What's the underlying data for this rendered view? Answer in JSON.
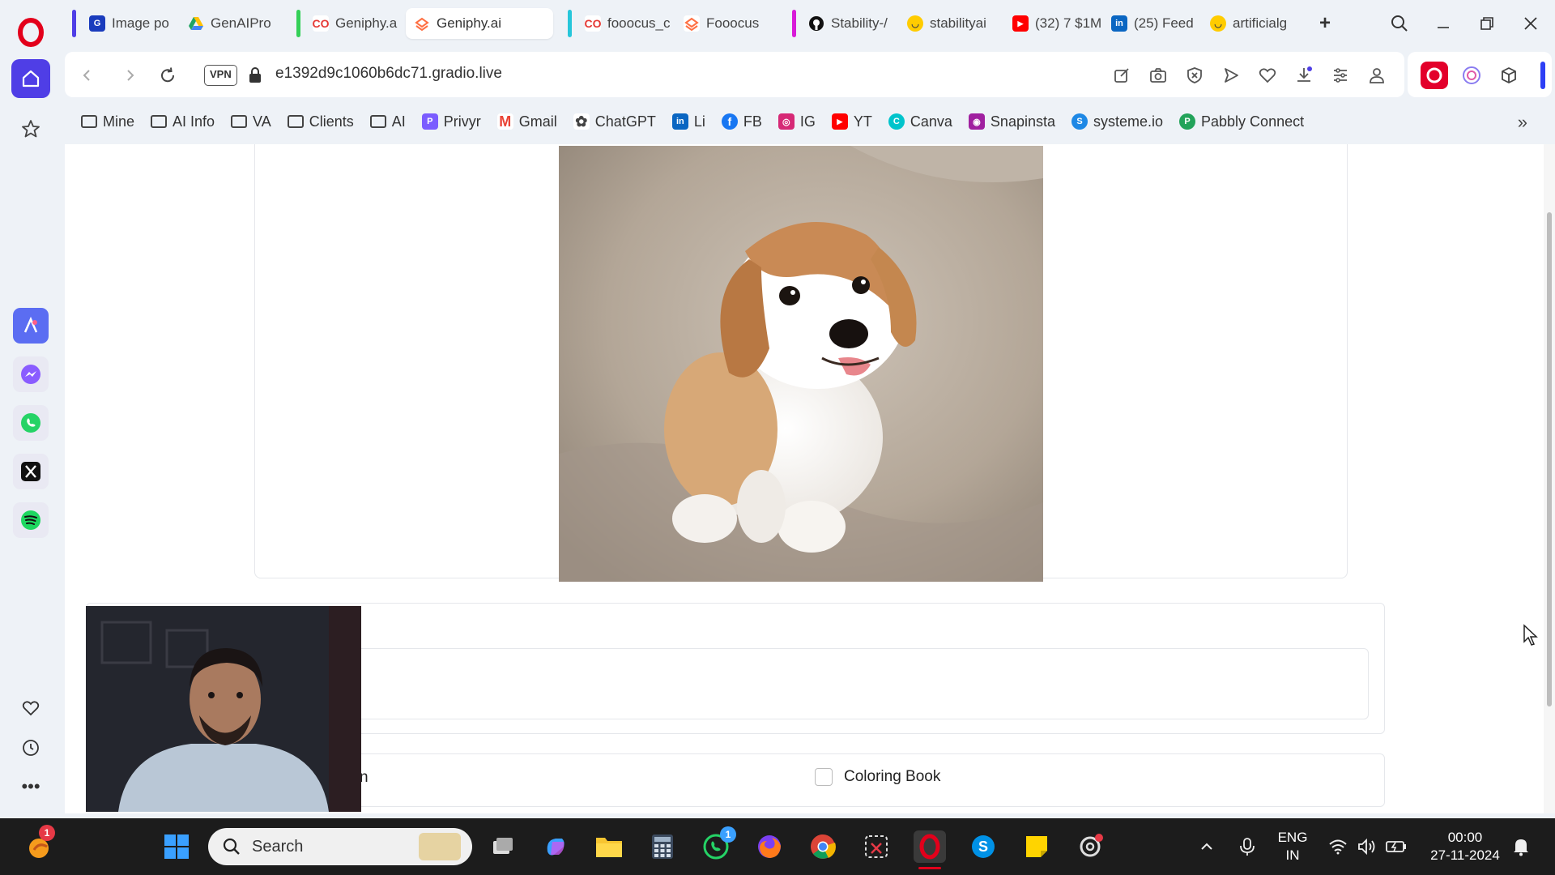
{
  "tabs": [
    {
      "label": "Image po",
      "icon": "gemini-icon",
      "color": "#1a3cbd"
    },
    {
      "label": "GenAIPro",
      "icon": "drive-icon",
      "color": "#f4b400"
    },
    {
      "label": "Geniphy.a",
      "icon": "geniphy-icon",
      "color": "#e53935"
    },
    {
      "label": "Geniphy.ai",
      "icon": "geniphy-ai-icon",
      "color": "#ff7043",
      "active": true
    },
    {
      "label": "fooocus_c",
      "icon": "fooocus-icon",
      "color": "#e53935"
    },
    {
      "label": "Fooocus",
      "icon": "fooocus-icon",
      "color": "#ff7043"
    },
    {
      "label": "Stability-/",
      "icon": "github-icon",
      "color": "#111111"
    },
    {
      "label": "stabilityai",
      "icon": "huggingface-icon",
      "color": "#ffcc00"
    },
    {
      "label": "(32) 7 $1M",
      "icon": "youtube-icon",
      "color": "#ff0000"
    },
    {
      "label": "(25) Feed",
      "icon": "linkedin-icon",
      "color": "#0a66c2"
    },
    {
      "label": "artificialg",
      "icon": "huggingface-icon",
      "color": "#ffcc00"
    }
  ],
  "address": {
    "url": "e1392d9c1060b6dc71.gradio.live",
    "vpn_label": "VPN"
  },
  "bookmarks": [
    {
      "label": "Mine",
      "type": "folder"
    },
    {
      "label": "AI Info",
      "type": "folder"
    },
    {
      "label": "VA",
      "type": "folder"
    },
    {
      "label": "Clients",
      "type": "folder"
    },
    {
      "label": "AI",
      "type": "folder"
    },
    {
      "label": "Privyr",
      "type": "site",
      "color": "#7b5cff"
    },
    {
      "label": "Gmail",
      "type": "site",
      "color": "#ea4335"
    },
    {
      "label": "ChatGPT",
      "type": "site",
      "color": "#444444"
    },
    {
      "label": "Li",
      "type": "site",
      "color": "#0a66c2"
    },
    {
      "label": "FB",
      "type": "site",
      "color": "#1877f2"
    },
    {
      "label": "IG",
      "type": "site",
      "color": "#d62976"
    },
    {
      "label": "YT",
      "type": "site",
      "color": "#ff0000"
    },
    {
      "label": "Canva",
      "type": "site",
      "color": "#00c4cc"
    },
    {
      "label": "Snapinsta",
      "type": "site",
      "color": "#a020a0"
    },
    {
      "label": "systeme.io",
      "type": "site",
      "color": "#1e88e5"
    },
    {
      "label": "Pabbly Connect",
      "type": "site",
      "color": "#22a35a"
    }
  ],
  "content": {
    "option_partial": "n",
    "checkbox_label": "Coloring Book"
  },
  "taskbar": {
    "search_placeholder": "Search",
    "language_top": "ENG",
    "language_bottom": "IN",
    "time": "00:00",
    "date": "27-11-2024",
    "start_badge": "1",
    "whatsapp_badge": "1"
  },
  "colors": {
    "opera_accent": "#4f3ee6",
    "opera_red": "#e3001b"
  }
}
